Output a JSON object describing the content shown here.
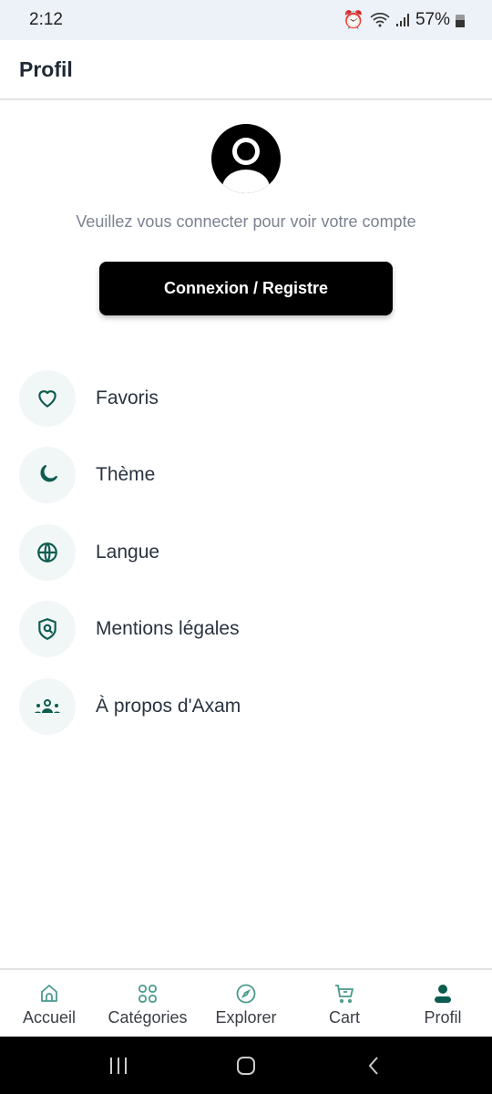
{
  "status_bar": {
    "time": "2:12",
    "battery": "57%"
  },
  "header": {
    "title": "Profil"
  },
  "profile": {
    "prompt": "Veuillez vous connecter pour voir votre compte",
    "login_button": "Connexion / Registre"
  },
  "menu": [
    {
      "label": "Favoris",
      "icon": "heart-icon"
    },
    {
      "label": "Thème",
      "icon": "moon-icon"
    },
    {
      "label": "Langue",
      "icon": "globe-icon"
    },
    {
      "label": "Mentions légales",
      "icon": "shield-icon"
    },
    {
      "label": "À propos d'Axam",
      "icon": "group-icon"
    }
  ],
  "bottom_nav": [
    {
      "label": "Accueil"
    },
    {
      "label": "Catégories"
    },
    {
      "label": "Explorer"
    },
    {
      "label": "Cart"
    },
    {
      "label": "Profil",
      "active": true
    }
  ],
  "colors": {
    "accent": "#0d5c4f",
    "icon_bg": "#f1f6f6"
  }
}
